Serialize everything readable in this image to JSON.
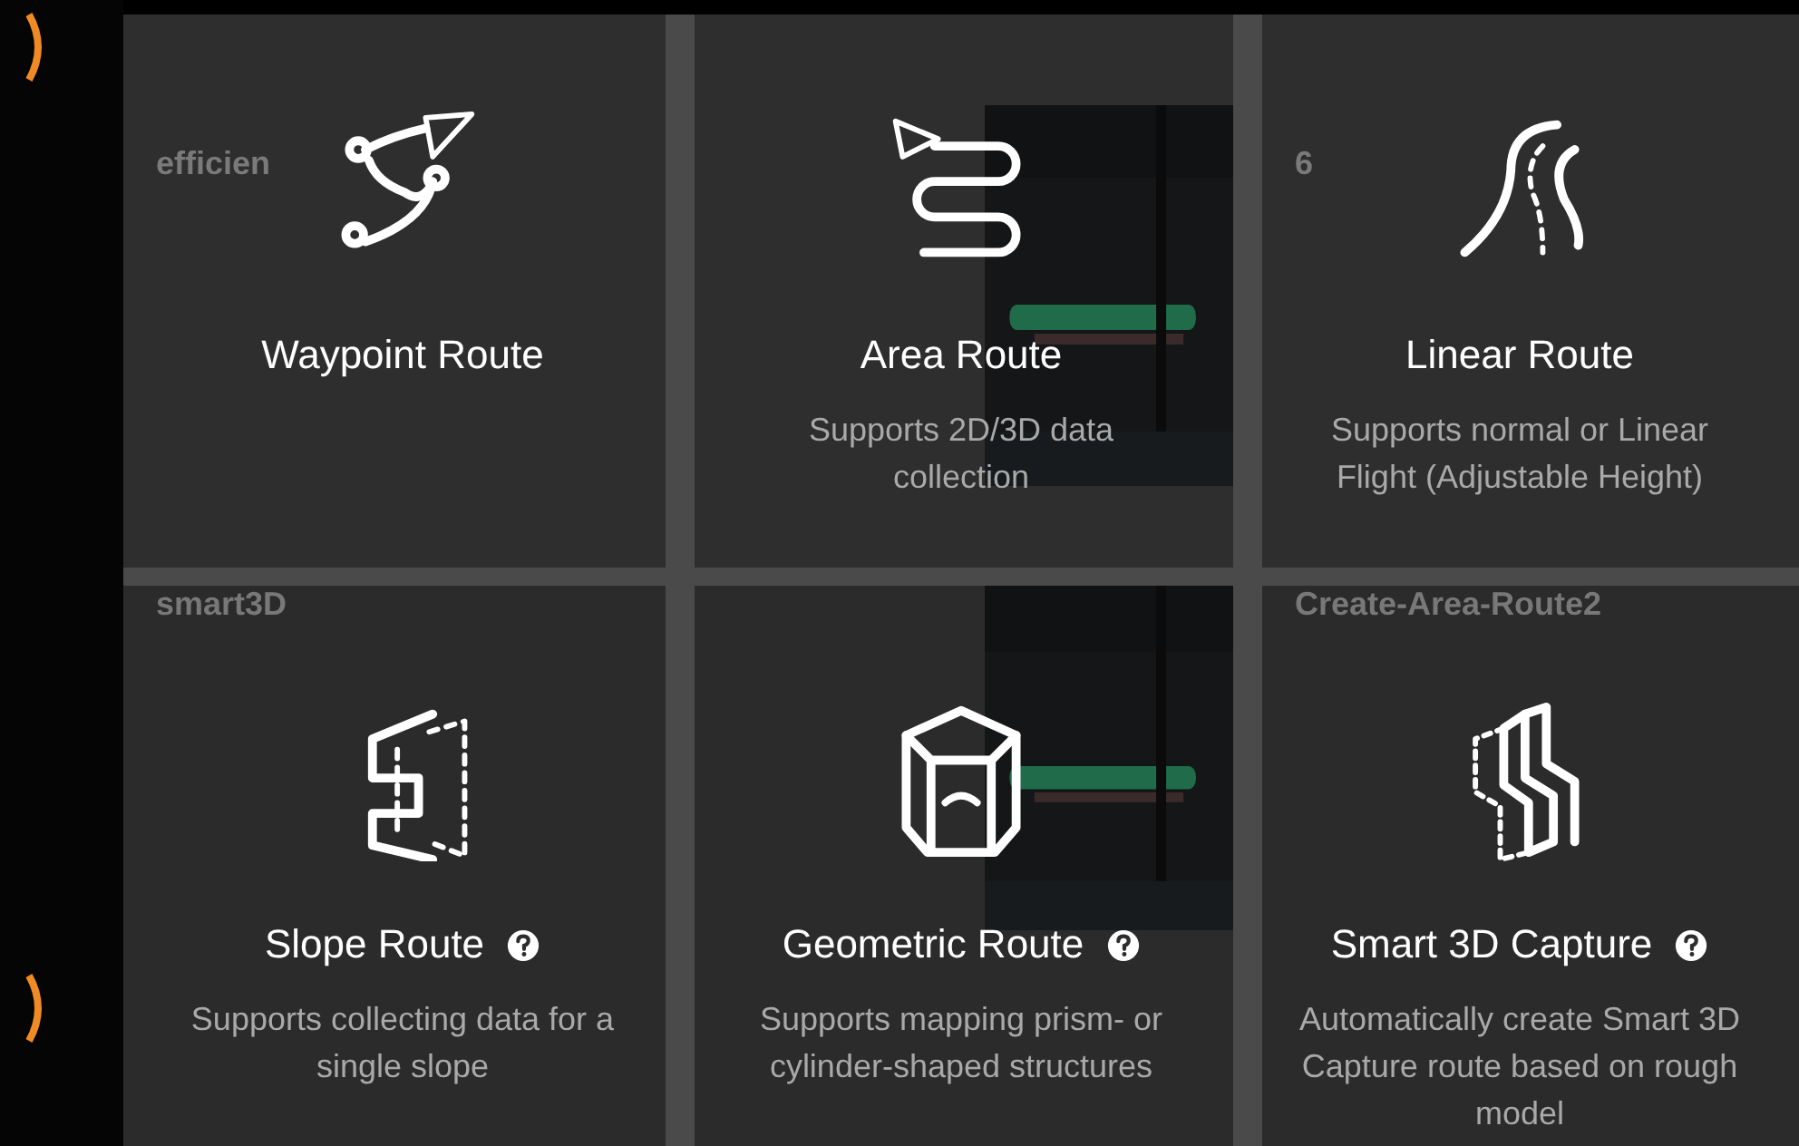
{
  "route_list": [
    {
      "kind": "plain",
      "title": "efficien"
    },
    {
      "kind": "map"
    },
    {
      "kind": "plain",
      "title": "6"
    },
    {
      "kind": "plain",
      "title": "smart3D"
    },
    {
      "kind": "map"
    },
    {
      "kind": "plain",
      "title": "Create-Area-Route2"
    }
  ],
  "route_types": [
    {
      "kind": "waypoint",
      "title": "Waypoint Route",
      "help": false
    },
    {
      "kind": "area",
      "title": "Area Route",
      "description": "Supports 2D/3D data\ncollection",
      "help": false
    },
    {
      "kind": "linear",
      "title": "Linear Route",
      "description": "Supports normal or Linear\nFlight (Adjustable Height)",
      "help": false
    },
    {
      "kind": "slope",
      "title": "Slope Route",
      "description": "Supports collecting data for a\nsingle slope",
      "help": true
    },
    {
      "kind": "geometric",
      "title": "Geometric Route",
      "description": "Supports mapping prism- or\ncylinder-shaped structures",
      "help": true
    },
    {
      "kind": "smart3d",
      "title": "Smart 3D Capture",
      "description": "Automatically create Smart 3D\nCapture route based on rough\nmodel",
      "help": true
    }
  ]
}
